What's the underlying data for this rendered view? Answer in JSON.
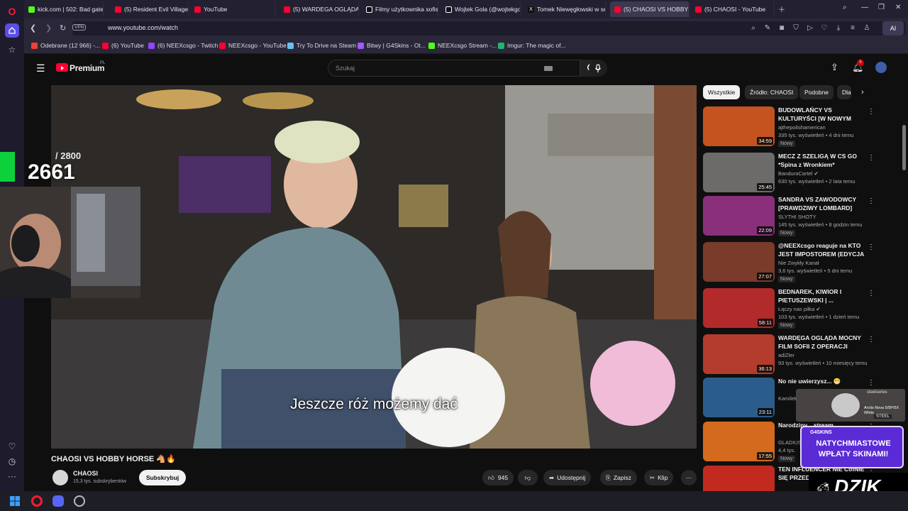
{
  "browser": {
    "tabs": [
      {
        "title": "kick.com | 502: Bad gatew",
        "color": "#53fc18"
      },
      {
        "title": "(5) Resident Evil Village - /",
        "color": "#ff0033"
      },
      {
        "title": "YouTube",
        "color": "#ff0033"
      },
      {
        "title": "(5) WARDEGA OGLĄDA L",
        "color": "#ff0033"
      },
      {
        "title": "Filmy użytkownika sofisiv",
        "color": "#ffffff"
      },
      {
        "title": "Wojtek Gola (@wojtekgo",
        "color": "#ffffff"
      },
      {
        "title": "Tomek Niewęgłowski w se",
        "color": "#ffffff"
      },
      {
        "title": "(5) CHAOSI VS HOBBY",
        "color": "#ff0033"
      },
      {
        "title": "(5) CHAOSI - YouTube",
        "color": "#ff0033"
      }
    ],
    "address": {
      "vpn_label": "VPN",
      "url": "www.youtube.com/watch",
      "ai_label": "AI"
    },
    "bookmarks": [
      {
        "label": "Odebrane (12 966) -...",
        "color": "#ea4335"
      },
      {
        "label": "(6) YouTube",
        "color": "#ff0033"
      },
      {
        "label": "(6) NEEXcsgo - Twitch",
        "color": "#9146ff"
      },
      {
        "label": "NEEXcsgo - YouTube",
        "color": "#ff0033"
      },
      {
        "label": "Try To Drive na Steam",
        "color": "#66c0f4"
      },
      {
        "label": "Bitwy | G4Skins - Ot...",
        "color": "#a259ff"
      },
      {
        "label": "NEEXcsgo Stream -...",
        "color": "#53fc18"
      },
      {
        "label": "Imgur: The magic of...",
        "color": "#1bb76e"
      }
    ]
  },
  "youtube": {
    "logo_text": "Premium",
    "logo_region": "PL",
    "search_placeholder": "Szukaj",
    "notifications_count": "5",
    "video": {
      "subtitle": "Jeszcze róż możemy dać",
      "title": "CHAOSI VS HOBBY HORSE 🐴🔥",
      "channel": "CHAOSI",
      "subscribers": "15,3 tys. subskrybentów",
      "subscribe_label": "Subskrybuj",
      "likes": "945",
      "share_label": "Udostępnij",
      "save_label": "Zapisz",
      "clip_label": "Klip"
    },
    "chips": [
      "Wszystkie",
      "Źródło: CHAOSI",
      "Podobne",
      "Dla"
    ],
    "recommended": [
      {
        "title": "BUDOWLAŃCY VS KULTURYŚCI [W NOWYM DOMU ...",
        "channel": "ajthepolishamerican",
        "meta": "335 tys. wyświetleń • 4 dni temu",
        "badge": "Nowy",
        "duration": "34:59",
        "thumb": "#c4531f"
      },
      {
        "title": "MECZ Z SZELIGĄ W CS GO *Spina z Wronkiem*",
        "channel": "BanduraCartel ✔",
        "meta": "630 tys. wyświetleń • 2 lata temu",
        "badge": "",
        "duration": "25:45",
        "thumb": "#6d6a6a"
      },
      {
        "title": "SANDRA VS ZAWODOWCY [PRAWDZIWY LOMBARD]",
        "channel": "SLYTHI SHOTY",
        "meta": "145 tys. wyświetleń • 8 godzin temu",
        "badge": "Nowy",
        "duration": "22:09",
        "thumb": "#8a2f7a"
      },
      {
        "title": "@NEEXcsgo reaguje na KTO JEST IMPOSTOREM (EDYCJA ...",
        "channel": "Nie Zwykły Kanał",
        "meta": "3,6 tys. wyświetleń • 5 dni temu",
        "badge": "Nowy",
        "duration": "27:07",
        "thumb": "#7a3b2a"
      },
      {
        "title": "BEDNAREK, KIWIOR I PIETUSZEWSKI | ...",
        "channel": "Łączy nas piłka ✔",
        "meta": "103 tys. wyświetleń • 1 dzień temu",
        "badge": "Nowy",
        "duration": "58:11",
        "thumb": "#b22a2a"
      },
      {
        "title": "WARDĘGA OGLĄDA MOCNY FILM SOFII Z OPERACJI BIUSTU",
        "channel": "adiZler",
        "meta": "93 tys. wyświetleń • 10 miesięcy temu",
        "badge": "",
        "duration": "36:13",
        "thumb": "#b43c2c"
      },
      {
        "title": "No nie uwierzysz... 😁",
        "channel": "Kamilek",
        "meta": "",
        "badge": "",
        "duration": "23:11",
        "thumb": "#2b5d8c"
      },
      {
        "title": "Narodziny... stream...",
        "channel": "GLADIUS",
        "meta": "4,4 tys.",
        "badge": "Nowy",
        "duration": "17:55",
        "thumb": "#d46a1e"
      },
      {
        "title": "TEN INFLUENCER NIE CofNIE SIĘ PRZED",
        "channel": "",
        "meta": "",
        "badge": "",
        "duration": "",
        "thumb": "#c22a1f"
      }
    ]
  },
  "stream_overlay": {
    "goal_current": "2661",
    "goal_max": "/ 2800",
    "ad_text": "NATYCHMIASTOWE WPŁATY SKINAMI!",
    "ad_brand": "G4SKINS",
    "sponsor": "DZIK",
    "headset_title": "Arctis Nova 5/5P/5X White",
    "headset_brand": "steelseries",
    "headset_tag": "STEEL"
  }
}
